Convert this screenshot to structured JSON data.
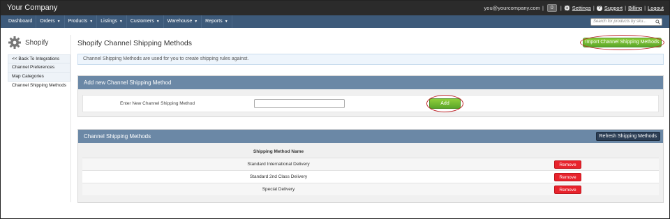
{
  "header": {
    "brand": "Your Company",
    "user_email": "you@yourcompany.com",
    "separator": "|",
    "count": "0",
    "links": [
      "Settings",
      "Support",
      "Billing",
      "Logout"
    ]
  },
  "nav": {
    "items": [
      {
        "label": "Dashboard",
        "dropdown": false
      },
      {
        "label": "Orders",
        "dropdown": true
      },
      {
        "label": "Products",
        "dropdown": true
      },
      {
        "label": "Listings",
        "dropdown": true
      },
      {
        "label": "Customers",
        "dropdown": true
      },
      {
        "label": "Warehouse",
        "dropdown": true
      },
      {
        "label": "Reports",
        "dropdown": true
      }
    ],
    "search_placeholder": "Search for products by sku..."
  },
  "sidebar": {
    "title": "Shopify",
    "items": [
      "<< Back To Integrations",
      "Channel Preferences",
      "Map Categories",
      "Channel Shipping Methods"
    ],
    "active_index": 3
  },
  "main": {
    "title": "Shopify Channel Shipping Methods",
    "import_button": "Import Channel Shipping Methods",
    "info_text": "Channel Shipping Methods are used for you to create shipping rules against.",
    "add_panel": {
      "title": "Add new Channel Shipping Method",
      "label": "Enter New Channel Shipping Method",
      "input_value": "",
      "add_button": "Add"
    },
    "list_panel": {
      "title": "Channel Shipping Methods",
      "refresh_button": "Refresh Shipping Methods",
      "column_header": "Shipping Method Name",
      "rows": [
        {
          "name": "Standard International Delivery",
          "action": "Remove"
        },
        {
          "name": "Standard 2nd Class Delivery",
          "action": "Remove"
        },
        {
          "name": "Special Delivery",
          "action": "Remove"
        }
      ]
    }
  },
  "colors": {
    "topbar": "#2b2b2b",
    "navbar": "#3d5a7a",
    "panel_header": "#6b88a6",
    "green_button": "#6cb52e",
    "remove_button": "#e8232c",
    "highlight_ring": "#c0282d"
  }
}
